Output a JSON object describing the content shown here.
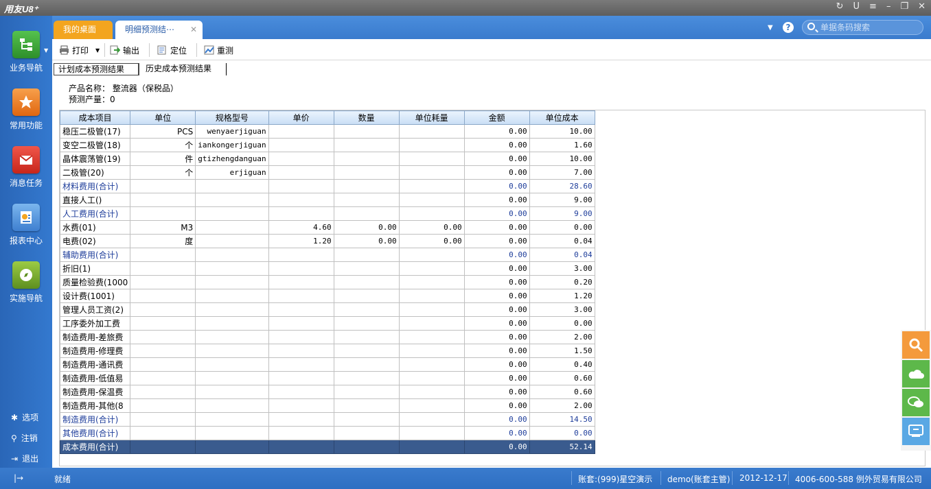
{
  "app": {
    "logo": "用友U8⁺"
  },
  "sidebar": {
    "items": [
      {
        "label": "业务导航",
        "icon": "business-nav-icon",
        "color": "#3ea53b"
      },
      {
        "label": "常用功能",
        "icon": "star-icon",
        "color": "#f07c18"
      },
      {
        "label": "消息任务",
        "icon": "mail-icon",
        "color": "#e23a2c"
      },
      {
        "label": "报表中心",
        "icon": "report-icon",
        "color": "#4a8fd8"
      },
      {
        "label": "实施导航",
        "icon": "compass-icon",
        "color": "#7aa82e"
      }
    ],
    "links": [
      {
        "label": "选项",
        "icon": "gear-icon"
      },
      {
        "label": "注销",
        "icon": "key-icon"
      },
      {
        "label": "退出",
        "icon": "exit-icon"
      }
    ]
  },
  "tabs": [
    {
      "label": "我的桌面"
    },
    {
      "label": "明细预测结⋯"
    }
  ],
  "search": {
    "placeholder": "单据条码搜索"
  },
  "toolbar": {
    "print": "打印",
    "export": "输出",
    "locate": "定位",
    "remeasure": "重测"
  },
  "subtabs": [
    "计划成本预测结果",
    "历史成本预测结果"
  ],
  "info": {
    "product_label": "产品名称：",
    "product_value": "整流器（保税品）",
    "qty_label": "预测产量：",
    "qty_value": "0"
  },
  "table": {
    "columns": [
      "成本项目",
      "单位",
      "规格型号",
      "单价",
      "数量",
      "单位耗量",
      "金额",
      "单位成本"
    ],
    "rows": [
      {
        "type": "item",
        "cells": [
          "稳压二极管(17)",
          "PCS",
          "wenyaerjiguan",
          "",
          "",
          "",
          "0.00",
          "10.00"
        ]
      },
      {
        "type": "item",
        "cells": [
          "变空二极管(18)",
          "个",
          "iankongerjiguan",
          "",
          "",
          "",
          "0.00",
          "1.60"
        ]
      },
      {
        "type": "item",
        "cells": [
          "晶体震荡管(19)",
          "件",
          "gtizhengdanguan",
          "",
          "",
          "",
          "0.00",
          "10.00"
        ]
      },
      {
        "type": "item",
        "cells": [
          "二极管(20)",
          "个",
          "erjiguan",
          "",
          "",
          "",
          "0.00",
          "7.00"
        ]
      },
      {
        "type": "subtotal",
        "cells": [
          "材料费用(合计)",
          "",
          "",
          "",
          "",
          "",
          "0.00",
          "28.60"
        ]
      },
      {
        "type": "item",
        "cells": [
          "直接人工()",
          "",
          "",
          "",
          "",
          "",
          "0.00",
          "9.00"
        ]
      },
      {
        "type": "subtotal",
        "cells": [
          "人工费用(合计)",
          "",
          "",
          "",
          "",
          "",
          "0.00",
          "9.00"
        ]
      },
      {
        "type": "item",
        "cells": [
          "水费(01)",
          "M3",
          "",
          "4.60",
          "0.00",
          "0.00",
          "0.00",
          "0.00"
        ]
      },
      {
        "type": "item",
        "cells": [
          "电费(02)",
          "度",
          "",
          "1.20",
          "0.00",
          "0.00",
          "0.00",
          "0.04"
        ]
      },
      {
        "type": "subtotal",
        "cells": [
          "辅助费用(合计)",
          "",
          "",
          "",
          "",
          "",
          "0.00",
          "0.04"
        ]
      },
      {
        "type": "item",
        "cells": [
          "折旧(1)",
          "",
          "",
          "",
          "",
          "",
          "0.00",
          "3.00"
        ]
      },
      {
        "type": "item",
        "cells": [
          "质量检验费(1000",
          "",
          "",
          "",
          "",
          "",
          "0.00",
          "0.20"
        ]
      },
      {
        "type": "item",
        "cells": [
          "设计费(1001)",
          "",
          "",
          "",
          "",
          "",
          "0.00",
          "1.20"
        ]
      },
      {
        "type": "item",
        "cells": [
          "管理人员工资(2)",
          "",
          "",
          "",
          "",
          "",
          "0.00",
          "3.00"
        ]
      },
      {
        "type": "item",
        "cells": [
          "工序委外加工费",
          "",
          "",
          "",
          "",
          "",
          "0.00",
          "0.00"
        ]
      },
      {
        "type": "item",
        "cells": [
          "制造费用-差旅费",
          "",
          "",
          "",
          "",
          "",
          "0.00",
          "2.00"
        ]
      },
      {
        "type": "item",
        "cells": [
          "制造费用-修理费",
          "",
          "",
          "",
          "",
          "",
          "0.00",
          "1.50"
        ]
      },
      {
        "type": "item",
        "cells": [
          "制造费用-通讯费",
          "",
          "",
          "",
          "",
          "",
          "0.00",
          "0.40"
        ]
      },
      {
        "type": "item",
        "cells": [
          "制造费用-低值易",
          "",
          "",
          "",
          "",
          "",
          "0.00",
          "0.60"
        ]
      },
      {
        "type": "item",
        "cells": [
          "制造费用-保温费",
          "",
          "",
          "",
          "",
          "",
          "0.00",
          "0.60"
        ]
      },
      {
        "type": "item",
        "cells": [
          "制造费用-其他(8",
          "",
          "",
          "",
          "",
          "",
          "0.00",
          "2.00"
        ]
      },
      {
        "type": "subtotal",
        "cells": [
          "制造费用(合计)",
          "",
          "",
          "",
          "",
          "",
          "0.00",
          "14.50"
        ]
      },
      {
        "type": "subtotal",
        "cells": [
          "其他费用(合计)",
          "",
          "",
          "",
          "",
          "",
          "0.00",
          "0.00"
        ]
      },
      {
        "type": "total",
        "cells": [
          "成本费用(合计)",
          "",
          "",
          "",
          "",
          "",
          "0.00",
          "52.14"
        ]
      }
    ]
  },
  "status": {
    "ready": "就绪",
    "account": "账套:(999)星空演示",
    "user": "demo(账套主管)",
    "date": "2012-12-17",
    "hotline": "4006-600-588 例外贸易有限公司"
  },
  "colors": {
    "brand_blue": "#2e6fc2",
    "tab_orange": "#f3a51f",
    "float_green": "#5db84a",
    "float_orange": "#f49a3c",
    "float_blue": "#5aa8e4"
  }
}
